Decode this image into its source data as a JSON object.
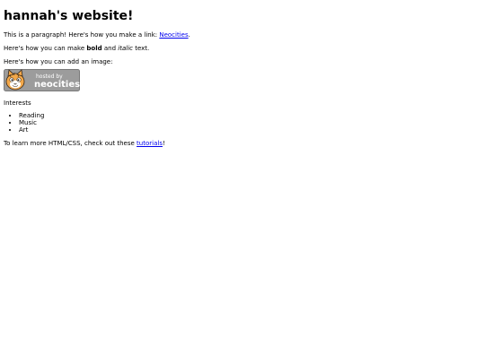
{
  "page": {
    "heading": "hannah's website!",
    "para1": {
      "text_before": "This is a paragraph! Here's how you make a link: ",
      "link_label": "Neocities",
      "text_after": "."
    },
    "para2": {
      "text_before": "Here's how you can make ",
      "bold": "bold",
      "text_middle": " and ",
      "italic": "italic",
      "text_after": " text."
    },
    "para3": "Here's how you can add an image:",
    "badge": {
      "line1": "hosted by",
      "line2": "neocities",
      "bg_color": "#9c9c9c",
      "text_color": "#ffffff",
      "icon": "neocities-cat-icon"
    },
    "interests_label": "Interests",
    "interests": [
      "Reading",
      "Music",
      "Art"
    ],
    "footer": {
      "text_before": "To learn more HTML/CSS, check out these ",
      "link_label": "tutorials",
      "text_after": "!"
    },
    "link_color": "#0000ee"
  }
}
